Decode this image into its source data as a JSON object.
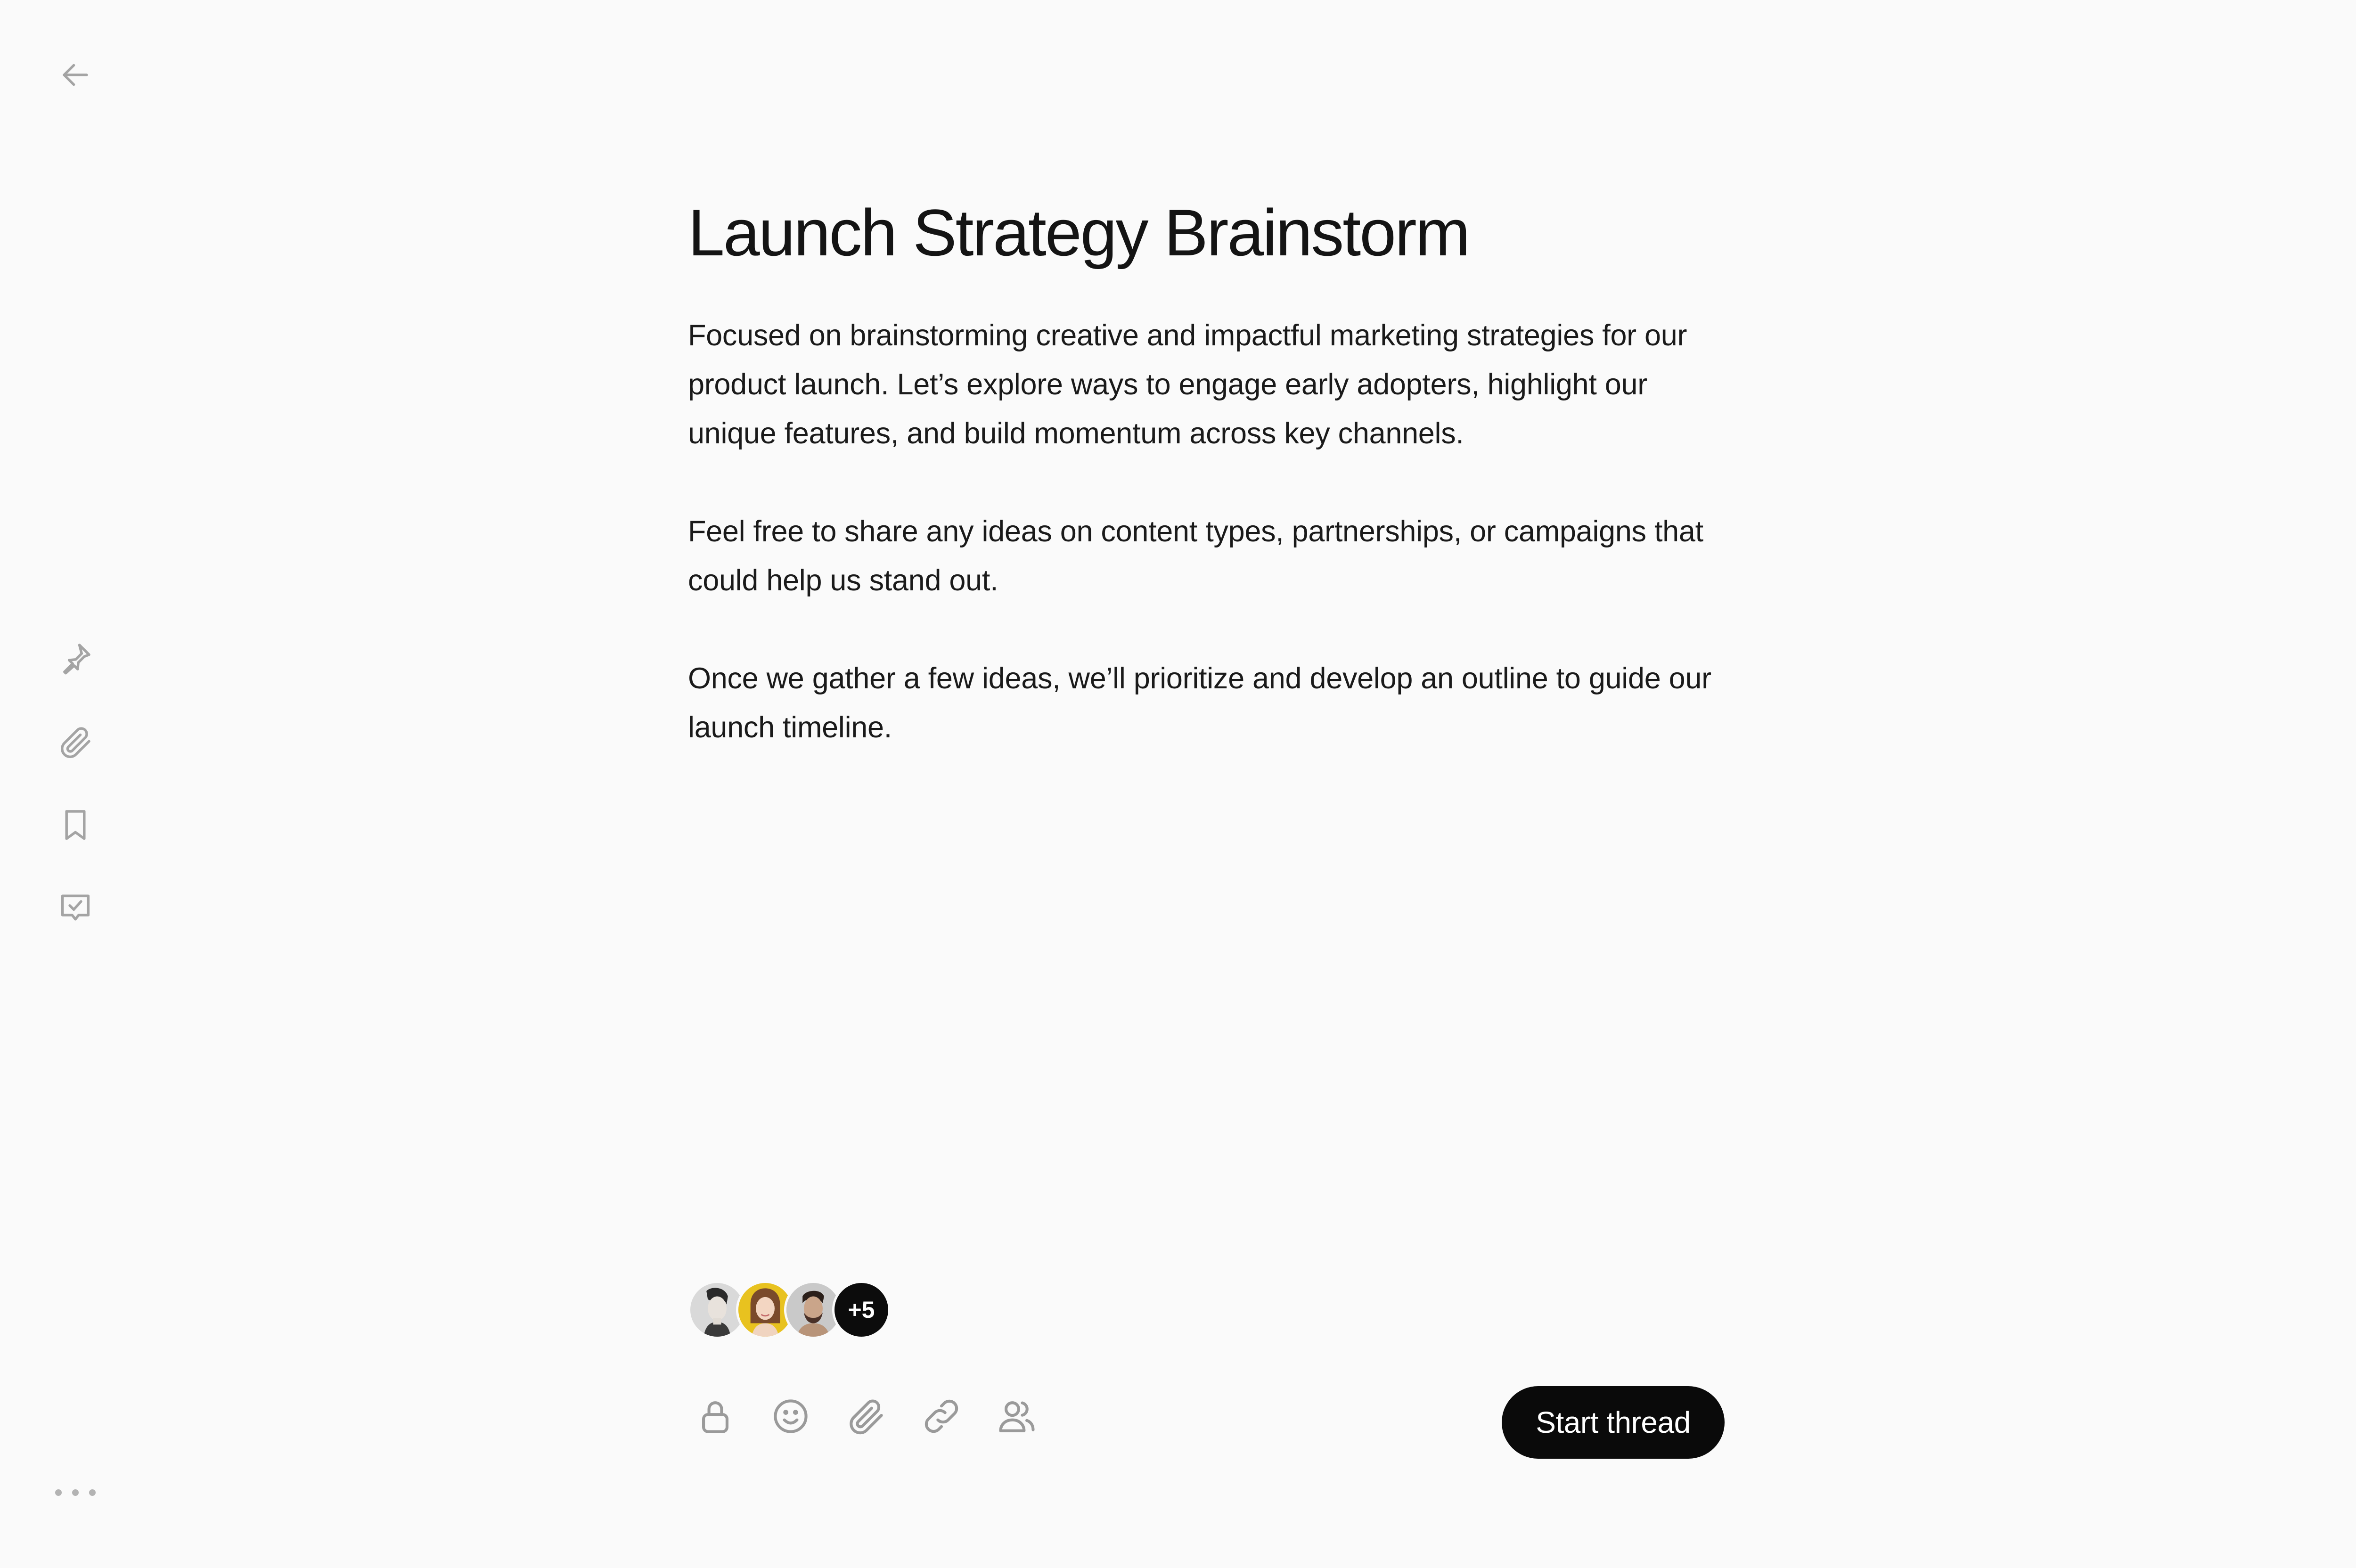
{
  "icons": {
    "back": "arrow-left-icon",
    "pin": "pin-icon",
    "attachment": "paperclip-icon",
    "bookmark": "bookmark-icon",
    "task": "checked-speech-bubble-icon",
    "more": "more-horizontal-icon"
  },
  "document": {
    "title": "Launch Strategy Brainstorm",
    "paragraphs": [
      "Focused on brainstorming creative and impactful marketing strategies for our product launch. Let’s explore ways to engage early adopters, highlight our unique features, and build momentum across key channels.",
      "Feel free to share any ideas on content types, partnerships, or campaigns that could help us stand out.",
      "Once we gather a few ideas, we’ll prioritize and develop an outline to guide our launch timeline."
    ]
  },
  "participants": {
    "visible_avatars": [
      "avatar-1",
      "avatar-2",
      "avatar-3"
    ],
    "more_count_label": "+5"
  },
  "composer": {
    "tools": [
      "lock-icon",
      "emoji-icon",
      "paperclip-icon",
      "link-icon",
      "users-icon"
    ],
    "submit_label": "Start thread"
  },
  "colors": {
    "background": "#fafafa",
    "text": "#141414",
    "icon": "#a4a4a4",
    "button": "#0a0a0a",
    "button_text": "#ffffff",
    "avatar_2_bg": "#e8c21f"
  }
}
